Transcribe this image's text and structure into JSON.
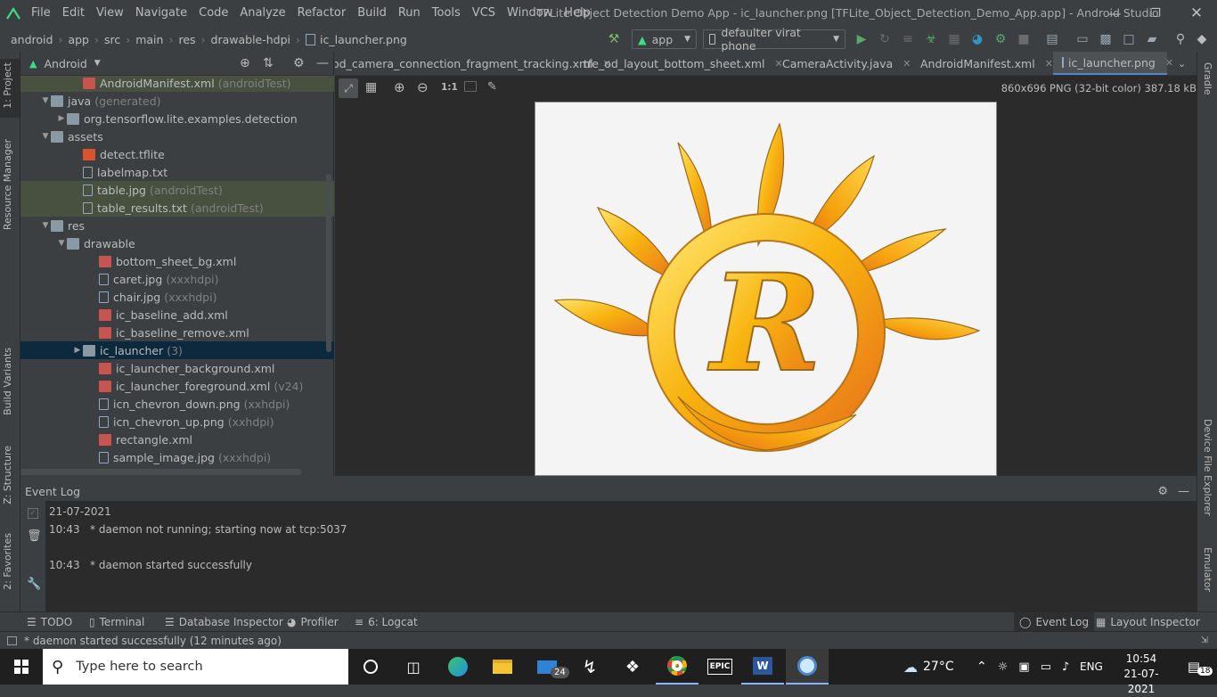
{
  "menu": {
    "items": [
      "File",
      "Edit",
      "View",
      "Navigate",
      "Code",
      "Analyze",
      "Refactor",
      "Build",
      "Run",
      "Tools",
      "VCS",
      "Window",
      "Help"
    ],
    "title": "TFLite Object Detection Demo App - ic_launcher.png [TFLite_Object_Detection_Demo_App.app] - Android Studio"
  },
  "breadcrumb": [
    "android",
    "app",
    "src",
    "main",
    "res",
    "drawable-hdpi",
    "ic_launcher.png"
  ],
  "toolbar": {
    "config": "app",
    "device": "defaulter virat phone"
  },
  "project": {
    "view": "Android",
    "tree": [
      {
        "label": "AndroidManifest.xml",
        "suffix": "(androidTest)",
        "depth": 3,
        "icon": "manifest",
        "highlight": true
      },
      {
        "label": "java",
        "suffix": "(generated)",
        "depth": 1,
        "icon": "folder",
        "expanded": true
      },
      {
        "label": "org.tensorflow.lite.examples.detection",
        "suffix": "",
        "depth": 2,
        "icon": "package",
        "collapsed": true
      },
      {
        "label": "assets",
        "suffix": "",
        "depth": 1,
        "icon": "folder",
        "expanded": true
      },
      {
        "label": "detect.tflite",
        "suffix": "",
        "depth": 3,
        "icon": "tflite"
      },
      {
        "label": "labelmap.txt",
        "suffix": "",
        "depth": 3,
        "icon": "text"
      },
      {
        "label": "table.jpg",
        "suffix": "(androidTest)",
        "depth": 3,
        "icon": "image",
        "highlight": true
      },
      {
        "label": "table_results.txt",
        "suffix": "(androidTest)",
        "depth": 3,
        "icon": "text",
        "highlight": true
      },
      {
        "label": "res",
        "suffix": "",
        "depth": 1,
        "icon": "folder",
        "expanded": true
      },
      {
        "label": "drawable",
        "suffix": "",
        "depth": 2,
        "icon": "folder",
        "expanded": true
      },
      {
        "label": "bottom_sheet_bg.xml",
        "suffix": "",
        "depth": 4,
        "icon": "xml"
      },
      {
        "label": "caret.jpg",
        "suffix": "(xxxhdpi)",
        "depth": 4,
        "icon": "image"
      },
      {
        "label": "chair.jpg",
        "suffix": "(xxxhdpi)",
        "depth": 4,
        "icon": "image"
      },
      {
        "label": "ic_baseline_add.xml",
        "suffix": "",
        "depth": 4,
        "icon": "xml"
      },
      {
        "label": "ic_baseline_remove.xml",
        "suffix": "",
        "depth": 4,
        "icon": "xml"
      },
      {
        "label": "ic_launcher",
        "suffix": "(3)",
        "depth": 3,
        "icon": "folder",
        "collapsed": true,
        "selected": true
      },
      {
        "label": "ic_launcher_background.xml",
        "suffix": "",
        "depth": 4,
        "icon": "xml"
      },
      {
        "label": "ic_launcher_foreground.xml",
        "suffix": "(v24)",
        "depth": 4,
        "icon": "xml"
      },
      {
        "label": "icn_chevron_down.png",
        "suffix": "(xxhdpi)",
        "depth": 4,
        "icon": "image"
      },
      {
        "label": "icn_chevron_up.png",
        "suffix": "(xxhdpi)",
        "depth": 4,
        "icon": "image"
      },
      {
        "label": "rectangle.xml",
        "suffix": "",
        "depth": 4,
        "icon": "xml"
      },
      {
        "label": "sample_image.jpg",
        "suffix": "(xxxhdpi)",
        "depth": 4,
        "icon": "image"
      }
    ]
  },
  "tabs": [
    {
      "label": "od_camera_connection_fragment_tracking.xml",
      "icon": "xml"
    },
    {
      "label": "tfe_od_layout_bottom_sheet.xml",
      "icon": "xml"
    },
    {
      "label": "CameraActivity.java",
      "icon": "java"
    },
    {
      "label": "AndroidManifest.xml",
      "icon": "manifest"
    },
    {
      "label": "ic_launcher.png",
      "icon": "image",
      "active": true
    }
  ],
  "editor": {
    "zoom_actual": "1:1",
    "image_info": "860x696 PNG (32-bit color) 387.18 kB",
    "image_letter": "R"
  },
  "eventlog": {
    "title": "Event Log",
    "date": "21-07-2021",
    "entries": [
      {
        "time": "10:43",
        "text": "* daemon not running; starting now at tcp:5037"
      },
      {
        "time": "10:43",
        "text": "* daemon started successfully"
      }
    ]
  },
  "side_tabs": {
    "left": [
      "1: Project",
      "Resource Manager",
      "Build Variants",
      "Z: Structure",
      "2: Favorites"
    ],
    "right": [
      "Gradle",
      "Device File Explorer",
      "Emulator"
    ]
  },
  "tool_tabs": {
    "left": [
      "TODO",
      "Terminal",
      "Database Inspector",
      "Profiler",
      "6: Logcat"
    ],
    "right": [
      "Event Log",
      "Layout Inspector"
    ]
  },
  "status": "* daemon started successfully (12 minutes ago)",
  "taskbar": {
    "search_placeholder": "Type here to search",
    "mail_badge": "24",
    "temperature": "27°C",
    "language": "ENG",
    "time": "10:54",
    "date": "21-07-2021",
    "notifications": "18"
  },
  "colors": {
    "accent": "#4a88c7",
    "selection": "#0d293e",
    "highlight": "#48513f",
    "editor_bg": "#2b2b2b",
    "panel_bg": "#3c3f41"
  }
}
